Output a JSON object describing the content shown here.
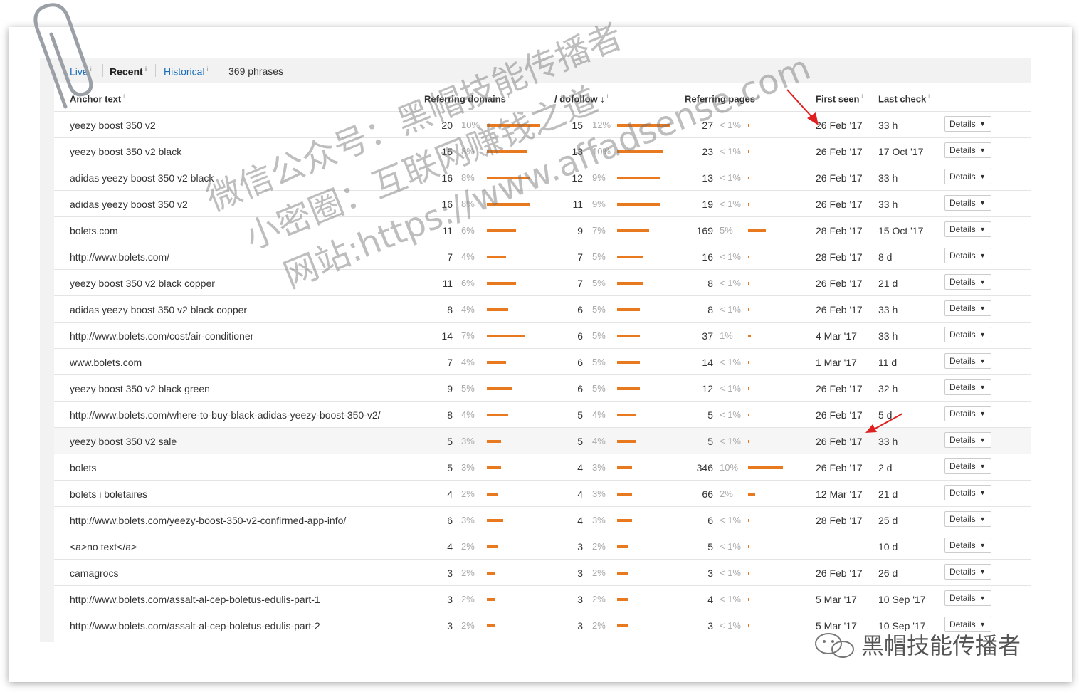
{
  "tabs": [
    {
      "label": "Live",
      "info": "i"
    },
    {
      "label": "Recent",
      "info": "i"
    },
    {
      "label": "Historical",
      "info": "i"
    }
  ],
  "phrase_count": "369 phrases",
  "columns": {
    "anchor": "Anchor text",
    "ref_domains": "Referring domains",
    "dofollow": "/ dofollow ↓",
    "ref_pages": "Referring pages",
    "first_seen": "First seen",
    "last_check": "Last check",
    "info": "i"
  },
  "details_label": "Details",
  "rows": [
    {
      "anchor": "yeezy boost 350 v2",
      "rd": "20",
      "rdp": "10%",
      "rdf": 1.0,
      "df": "15",
      "dfp": "12%",
      "dff": 1.0,
      "rp": "27",
      "rpp": "< 1%",
      "rpf": 0.05,
      "first": "26 Feb '17",
      "last": "33 h"
    },
    {
      "anchor": "yeezy boost 350 v2 black",
      "rd": "15",
      "rdp": "8%",
      "rdf": 0.75,
      "df": "13",
      "dfp": "10%",
      "dff": 0.87,
      "rp": "23",
      "rpp": "< 1%",
      "rpf": 0.05,
      "first": "26 Feb '17",
      "last": "17 Oct '17"
    },
    {
      "anchor": "adidas yeezy boost 350 v2 black",
      "rd": "16",
      "rdp": "8%",
      "rdf": 0.8,
      "df": "12",
      "dfp": "9%",
      "dff": 0.8,
      "rp": "13",
      "rpp": "< 1%",
      "rpf": 0.05,
      "first": "26 Feb '17",
      "last": "33 h"
    },
    {
      "anchor": "adidas yeezy boost 350 v2",
      "rd": "16",
      "rdp": "8%",
      "rdf": 0.8,
      "df": "11",
      "dfp": "9%",
      "dff": 0.8,
      "rp": "19",
      "rpp": "< 1%",
      "rpf": 0.05,
      "first": "26 Feb '17",
      "last": "33 h"
    },
    {
      "anchor": "bolets.com",
      "rd": "11",
      "rdp": "6%",
      "rdf": 0.55,
      "df": "9",
      "dfp": "7%",
      "dff": 0.6,
      "rp": "169",
      "rpp": "5%",
      "rpf": 0.5,
      "first": "28 Feb '17",
      "last": "15 Oct '17"
    },
    {
      "anchor": "http://www.bolets.com/",
      "rd": "7",
      "rdp": "4%",
      "rdf": 0.36,
      "df": "7",
      "dfp": "5%",
      "dff": 0.48,
      "rp": "16",
      "rpp": "< 1%",
      "rpf": 0.05,
      "first": "28 Feb '17",
      "last": "8 d"
    },
    {
      "anchor": "yeezy boost 350 v2 black copper",
      "rd": "11",
      "rdp": "6%",
      "rdf": 0.55,
      "df": "7",
      "dfp": "5%",
      "dff": 0.48,
      "rp": "8",
      "rpp": "< 1%",
      "rpf": 0.04,
      "first": "26 Feb '17",
      "last": "21 d"
    },
    {
      "anchor": "adidas yeezy boost 350 v2 black copper",
      "rd": "8",
      "rdp": "4%",
      "rdf": 0.4,
      "df": "6",
      "dfp": "5%",
      "dff": 0.42,
      "rp": "8",
      "rpp": "< 1%",
      "rpf": 0.04,
      "first": "26 Feb '17",
      "last": "33 h"
    },
    {
      "anchor": "http://www.bolets.com/cost/air-conditioner",
      "rd": "14",
      "rdp": "7%",
      "rdf": 0.7,
      "df": "6",
      "dfp": "5%",
      "dff": 0.42,
      "rp": "37",
      "rpp": "1%",
      "rpf": 0.08,
      "first": "4 Mar '17",
      "last": "33 h"
    },
    {
      "anchor": "www.bolets.com",
      "rd": "7",
      "rdp": "4%",
      "rdf": 0.36,
      "df": "6",
      "dfp": "5%",
      "dff": 0.42,
      "rp": "14",
      "rpp": "< 1%",
      "rpf": 0.05,
      "first": "1 Mar '17",
      "last": "11 d"
    },
    {
      "anchor": "yeezy boost 350 v2 black green",
      "rd": "9",
      "rdp": "5%",
      "rdf": 0.46,
      "df": "6",
      "dfp": "5%",
      "dff": 0.42,
      "rp": "12",
      "rpp": "< 1%",
      "rpf": 0.05,
      "first": "26 Feb '17",
      "last": "32 h"
    },
    {
      "anchor": "http://www.bolets.com/where-to-buy-black-adidas-yeezy-boost-350-v2/",
      "rd": "8",
      "rdp": "4%",
      "rdf": 0.4,
      "df": "5",
      "dfp": "4%",
      "dff": 0.35,
      "rp": "5",
      "rpp": "< 1%",
      "rpf": 0.03,
      "first": "26 Feb '17",
      "last": "5 d"
    },
    {
      "anchor": "yeezy boost 350 v2 sale",
      "rd": "5",
      "rdp": "3%",
      "rdf": 0.27,
      "df": "5",
      "dfp": "4%",
      "dff": 0.35,
      "rp": "5",
      "rpp": "< 1%",
      "rpf": 0.03,
      "first": "26 Feb '17",
      "last": "33 h",
      "highlight": true
    },
    {
      "anchor": "bolets",
      "rd": "5",
      "rdp": "3%",
      "rdf": 0.27,
      "df": "4",
      "dfp": "3%",
      "dff": 0.28,
      "rp": "346",
      "rpp": "10%",
      "rpf": 1.0,
      "first": "26 Feb '17",
      "last": "2 d"
    },
    {
      "anchor": "bolets i boletaires",
      "rd": "4",
      "rdp": "2%",
      "rdf": 0.2,
      "df": "4",
      "dfp": "3%",
      "dff": 0.28,
      "rp": "66",
      "rpp": "2%",
      "rpf": 0.2,
      "first": "12 Mar '17",
      "last": "21 d"
    },
    {
      "anchor": "http://www.bolets.com/yeezy-boost-350-v2-confirmed-app-info/",
      "rd": "6",
      "rdp": "3%",
      "rdf": 0.3,
      "df": "4",
      "dfp": "3%",
      "dff": 0.28,
      "rp": "6",
      "rpp": "< 1%",
      "rpf": 0.03,
      "first": "28 Feb '17",
      "last": "25 d"
    },
    {
      "anchor": "<a>no text</a>",
      "rd": "4",
      "rdp": "2%",
      "rdf": 0.2,
      "df": "3",
      "dfp": "2%",
      "dff": 0.21,
      "rp": "5",
      "rpp": "< 1%",
      "rpf": 0.03,
      "first": "",
      "last": "10 d"
    },
    {
      "anchor": "camagrocs",
      "rd": "3",
      "rdp": "2%",
      "rdf": 0.15,
      "df": "3",
      "dfp": "2%",
      "dff": 0.21,
      "rp": "3",
      "rpp": "< 1%",
      "rpf": 0.02,
      "first": "26 Feb '17",
      "last": "26 d"
    },
    {
      "anchor": "http://www.bolets.com/assalt-al-cep-boletus-edulis-part-1",
      "rd": "3",
      "rdp": "2%",
      "rdf": 0.15,
      "df": "3",
      "dfp": "2%",
      "dff": 0.21,
      "rp": "4",
      "rpp": "< 1%",
      "rpf": 0.03,
      "first": "5 Mar '17",
      "last": "10 Sep '17"
    },
    {
      "anchor": "http://www.bolets.com/assalt-al-cep-boletus-edulis-part-2",
      "rd": "3",
      "rdp": "2%",
      "rdf": 0.15,
      "df": "3",
      "dfp": "2%",
      "dff": 0.21,
      "rp": "3",
      "rpp": "< 1%",
      "rpf": 0.02,
      "first": "5 Mar '17",
      "last": "10 Sep '17"
    }
  ],
  "watermark": {
    "line1": "微信公众号：黑帽技能传播者",
    "line2": "小密圈：互联网赚钱之道",
    "line3": "网站:https://www.affadsense.com"
  },
  "footer_brand": "黑帽技能传播者",
  "colors": {
    "bar": "#e8791e",
    "link": "#1a6dbb",
    "arrow": "#e02020"
  }
}
